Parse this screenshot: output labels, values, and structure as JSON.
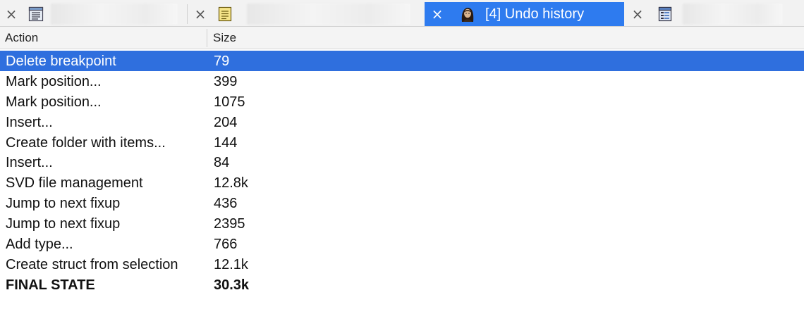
{
  "tabs": [
    {
      "title": "",
      "icon": "list-window-icon",
      "active": false
    },
    {
      "title": "",
      "icon": "notes-icon",
      "active": false
    },
    {
      "title": "[4] Undo history",
      "icon": "portrait-icon",
      "active": true
    },
    {
      "title": "",
      "icon": "structure-window-icon",
      "active": false
    }
  ],
  "table": {
    "columns": [
      "Action",
      "Size"
    ],
    "rows": [
      {
        "action": "Delete breakpoint",
        "size": "79"
      },
      {
        "action": "Mark position...",
        "size": "399"
      },
      {
        "action": "Mark position...",
        "size": "1075"
      },
      {
        "action": "Insert...",
        "size": "204"
      },
      {
        "action": "Create folder with items...",
        "size": "144"
      },
      {
        "action": "Insert...",
        "size": "84"
      },
      {
        "action": "SVD file management",
        "size": "12.8k"
      },
      {
        "action": "Jump to next fixup",
        "size": "436"
      },
      {
        "action": "Jump to next fixup",
        "size": "2395"
      },
      {
        "action": "Add type...",
        "size": "766"
      },
      {
        "action": "Create struct from selection",
        "size": "12.1k"
      },
      {
        "action": "FINAL STATE",
        "size": "30.3k"
      }
    ],
    "selected_row": 0
  },
  "colors": {
    "selection": "#2f6fde",
    "active_tab": "#2e7bef"
  }
}
